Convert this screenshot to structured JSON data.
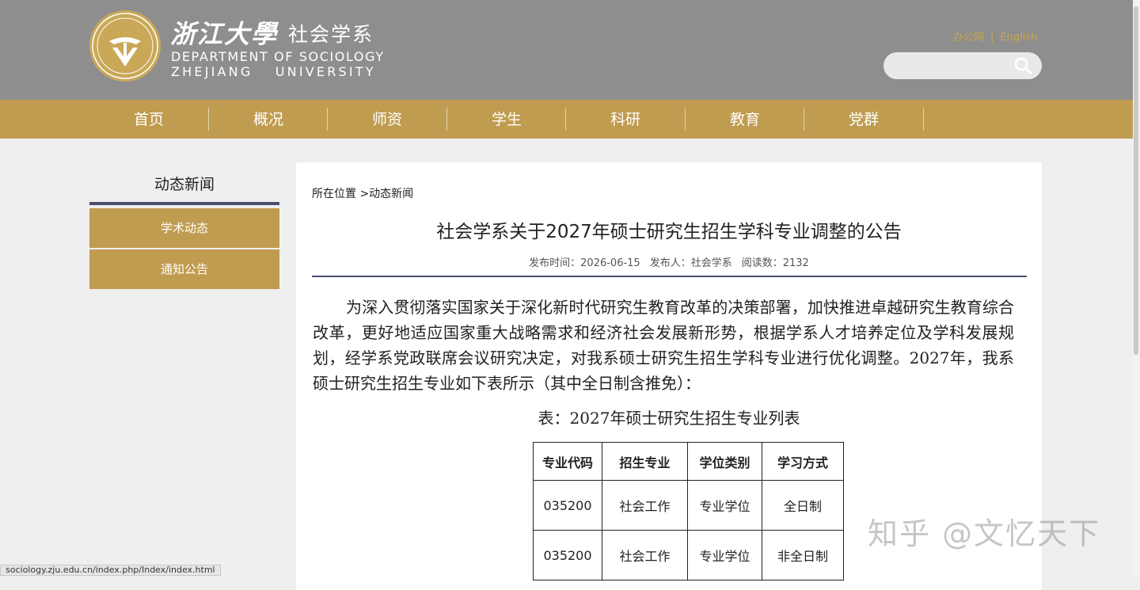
{
  "header": {
    "brand_cn": "浙江大學",
    "dept_cn": "社会学系",
    "dept_en_line1": "DEPARTMENT OF SOCIOLOGY",
    "dept_en_line2": "ZHEJIANG UNIVERSITY",
    "top_links": {
      "office": "办公网",
      "separator": "|",
      "english": "English"
    },
    "search": {
      "placeholder": "",
      "icon": "search-icon"
    },
    "colors": {
      "header_bg": "#8e8e8e",
      "accent": "#c09c50",
      "link": "#c8a64f"
    }
  },
  "nav": {
    "items": [
      "首页",
      "概况",
      "师资",
      "学生",
      "科研",
      "教育",
      "党群"
    ]
  },
  "sidebar": {
    "title": "动态新闻",
    "items": [
      "学术动态",
      "通知公告"
    ]
  },
  "article": {
    "breadcrumb": "所在位置 >动态新闻",
    "title": "社会学系关于2027年硕士研究生招生学科专业调整的公告",
    "meta": {
      "date": "发布时间：2026-06-15",
      "author": "发布人：社会学系",
      "reads": "阅读数：2132"
    },
    "paragraph": "为深入贯彻落实国家关于深化新时代研究生教育改革的决策部署，加快推进卓越研究生教育综合改革，更好地适应国家重大战略需求和经济社会发展新形势，根据学系人才培养定位及学科发展规划，经学系党政联席会议研究决定，对我系硕士研究生招生学科专业进行优化调整。2027年，我系硕士研究生招生专业如下表所示（其中全日制含推免）：",
    "table_caption": "表：2027年硕士研究生招生专业列表",
    "table": {
      "headers": [
        "专业代码",
        "招生专业",
        "学位类别",
        "学习方式"
      ],
      "rows": [
        [
          "035200",
          "社会工作",
          "专业学位",
          "全日制"
        ],
        [
          "035200",
          "社会工作",
          "专业学位",
          "非全日制"
        ]
      ]
    }
  },
  "watermark": "知乎 @文忆天下",
  "status_url": "sociology.zju.edu.cn/index.php/Index/index.html"
}
